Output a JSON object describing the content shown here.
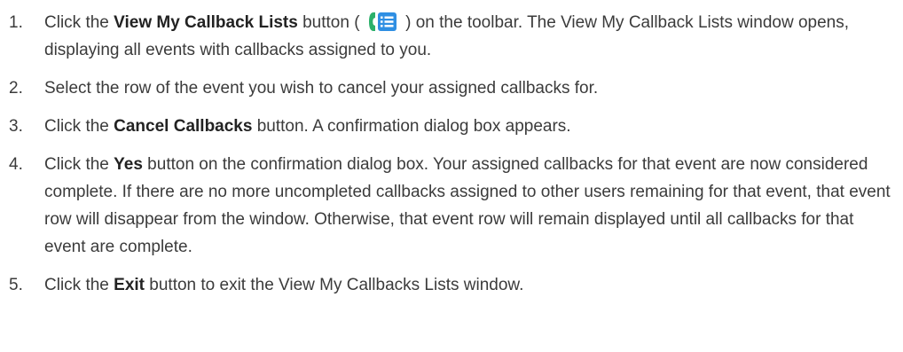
{
  "steps": [
    {
      "num": "1.",
      "pre": "Click the ",
      "bold": "View My Callback Lists",
      "mid": " button ( ",
      "icon": "callback-list-icon",
      "post": " ) on the toolbar. The View My Callback Lists window opens, displaying all events with callbacks assigned to you."
    },
    {
      "num": "2.",
      "text": "Select the row of the event you wish to cancel your assigned callbacks for."
    },
    {
      "num": "3.",
      "pre": "Click the ",
      "bold": "Cancel Callbacks",
      "post": " button. A confirmation dialog box appears."
    },
    {
      "num": "4.",
      "pre": "Click the ",
      "bold": "Yes",
      "post": " button on the confirmation dialog box. Your assigned callbacks for that event are now considered complete. If there are no more uncompleted callbacks assigned to other users remaining for that event, that event row will disappear from the window. Otherwise, that event row will remain displayed until all callbacks for that event are complete."
    },
    {
      "num": "5.",
      "pre": "Click the ",
      "bold": "Exit",
      "post": " button to exit the View My Callbacks Lists window."
    }
  ],
  "colors": {
    "icon_green": "#2bb06a",
    "icon_blue": "#2f8fe3"
  }
}
